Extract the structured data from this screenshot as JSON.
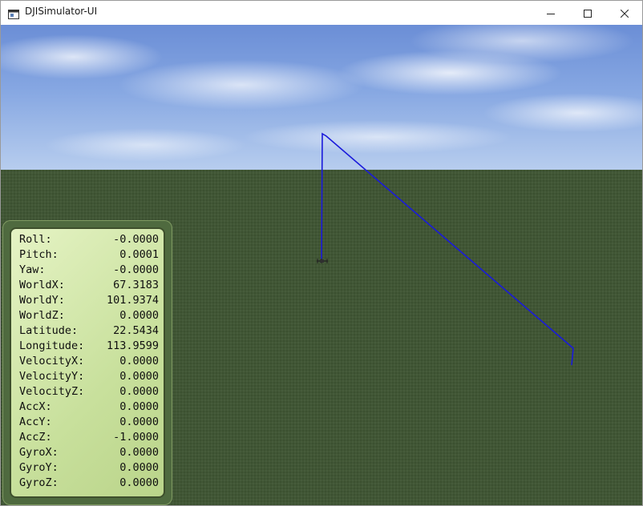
{
  "window": {
    "title": "DJISimulator-UI",
    "controls": [
      "minimize-icon",
      "maximize-icon",
      "close-icon"
    ]
  },
  "colors": {
    "trajectory": "#1a1adb",
    "ground": "#3f5633",
    "panel_bg": "#d3e8a8"
  },
  "telemetry": [
    {
      "label": "Roll:",
      "value": "-0.0000"
    },
    {
      "label": "Pitch:",
      "value": "0.0001"
    },
    {
      "label": "Yaw:",
      "value": "-0.0000"
    },
    {
      "label": "WorldX:",
      "value": "67.3183"
    },
    {
      "label": "WorldY:",
      "value": "101.9374"
    },
    {
      "label": "WorldZ:",
      "value": "0.0000"
    },
    {
      "label": "Latitude:",
      "value": "22.5434"
    },
    {
      "label": "Longitude:",
      "value": "113.9599"
    },
    {
      "label": "VelocityX:",
      "value": "0.0000"
    },
    {
      "label": "VelocityY:",
      "value": "0.0000"
    },
    {
      "label": "VelocityZ:",
      "value": "0.0000"
    },
    {
      "label": "AccX:",
      "value": "0.0000"
    },
    {
      "label": "AccY:",
      "value": "0.0000"
    },
    {
      "label": "AccZ:",
      "value": "-1.0000"
    },
    {
      "label": "GyroX:",
      "value": "0.0000"
    },
    {
      "label": "GyroY:",
      "value": "0.0000"
    },
    {
      "label": "GyroZ:",
      "value": "0.0000"
    }
  ]
}
